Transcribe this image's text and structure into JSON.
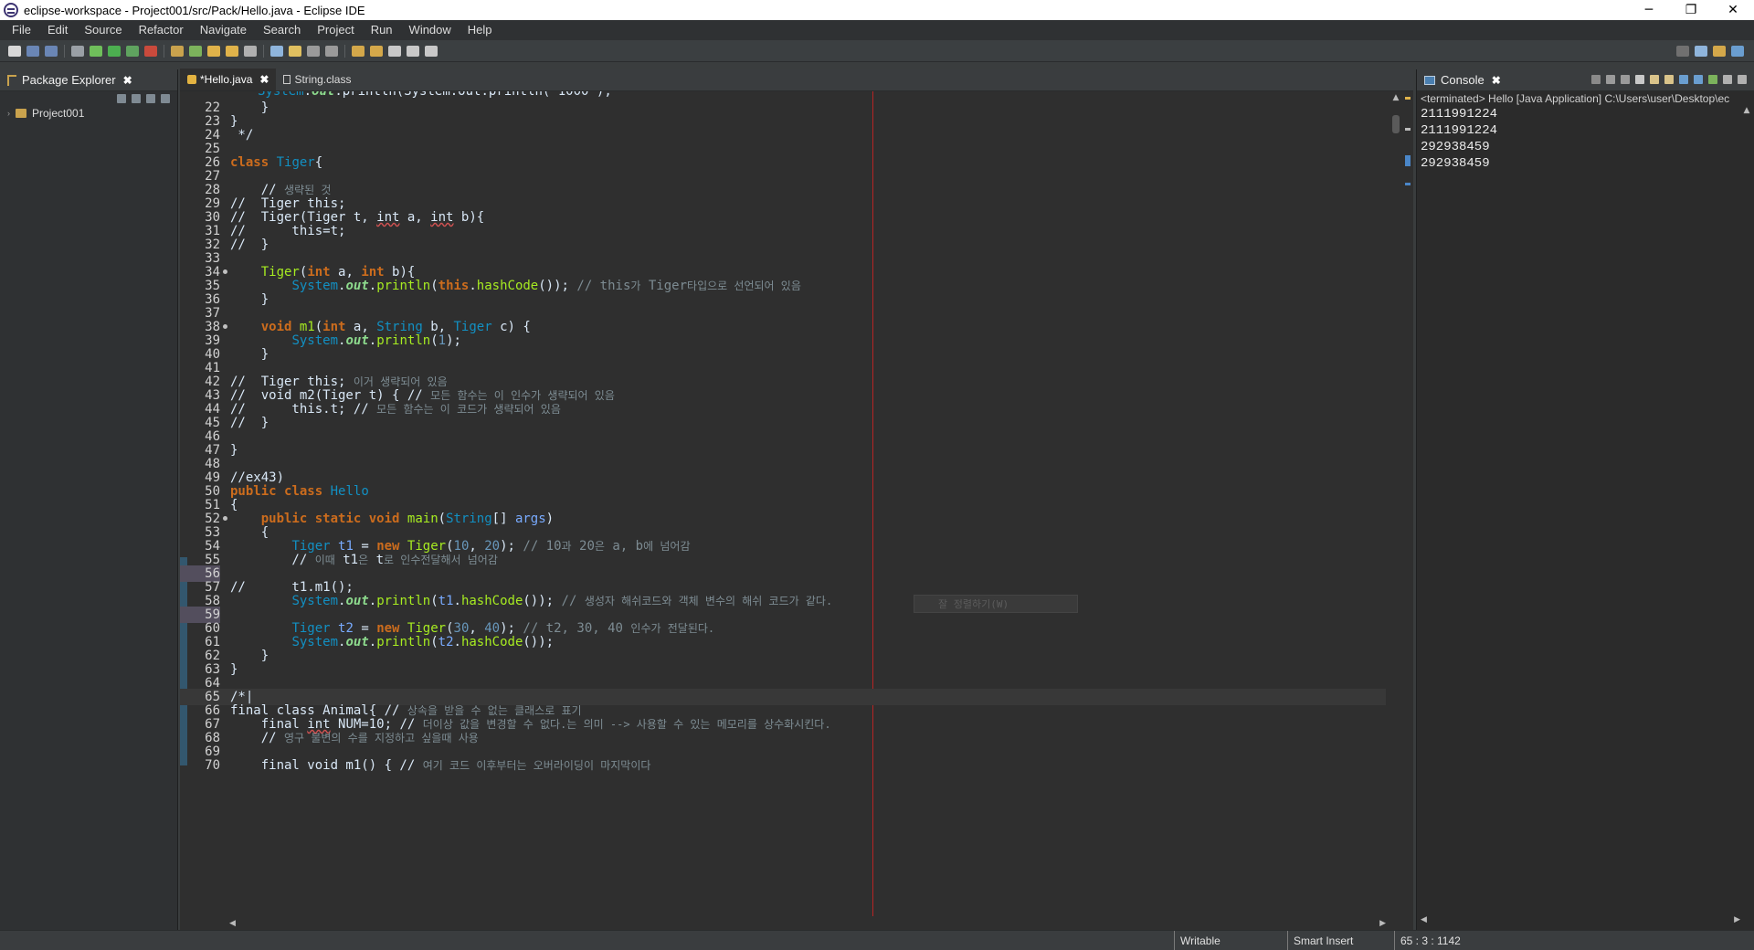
{
  "window": {
    "title": "eclipse-workspace - Project001/src/Pack/Hello.java - Eclipse IDE",
    "minimize": "─",
    "maximize": "❐",
    "close": "✕"
  },
  "menu": [
    "File",
    "Edit",
    "Source",
    "Refactor",
    "Navigate",
    "Search",
    "Project",
    "Run",
    "Window",
    "Help"
  ],
  "package_explorer": {
    "tab_label": "Package Explorer",
    "close": "✖",
    "project": "Project001",
    "chevron": "›"
  },
  "editor": {
    "tabs": [
      {
        "label": "*Hello.java",
        "close": "✖"
      },
      {
        "label": "String.class"
      }
    ],
    "ghost_popup": "잘 정렬하기(W)",
    "first_line_partial": "System.out.println(\"1000\");",
    "cursor_position": "65 : 3 : 1142"
  },
  "console": {
    "tab_label": "Console",
    "close": "✖",
    "terminated": "<terminated> Hello [Java Application] C:\\Users\\user\\Desktop\\ec",
    "output": [
      "2111991224",
      "2111991224",
      "292938459",
      "292938459"
    ]
  },
  "status": {
    "writable": "Writable",
    "insert_mode": "Smart Insert",
    "position": "65 : 3 : 1142"
  },
  "colors": {
    "keyword": "#cc6c1d",
    "type": "#1290c3",
    "method": "#a7ec21",
    "comment": "#7d8c93",
    "field": "#8dda8d",
    "print_margin": "#b72424"
  }
}
